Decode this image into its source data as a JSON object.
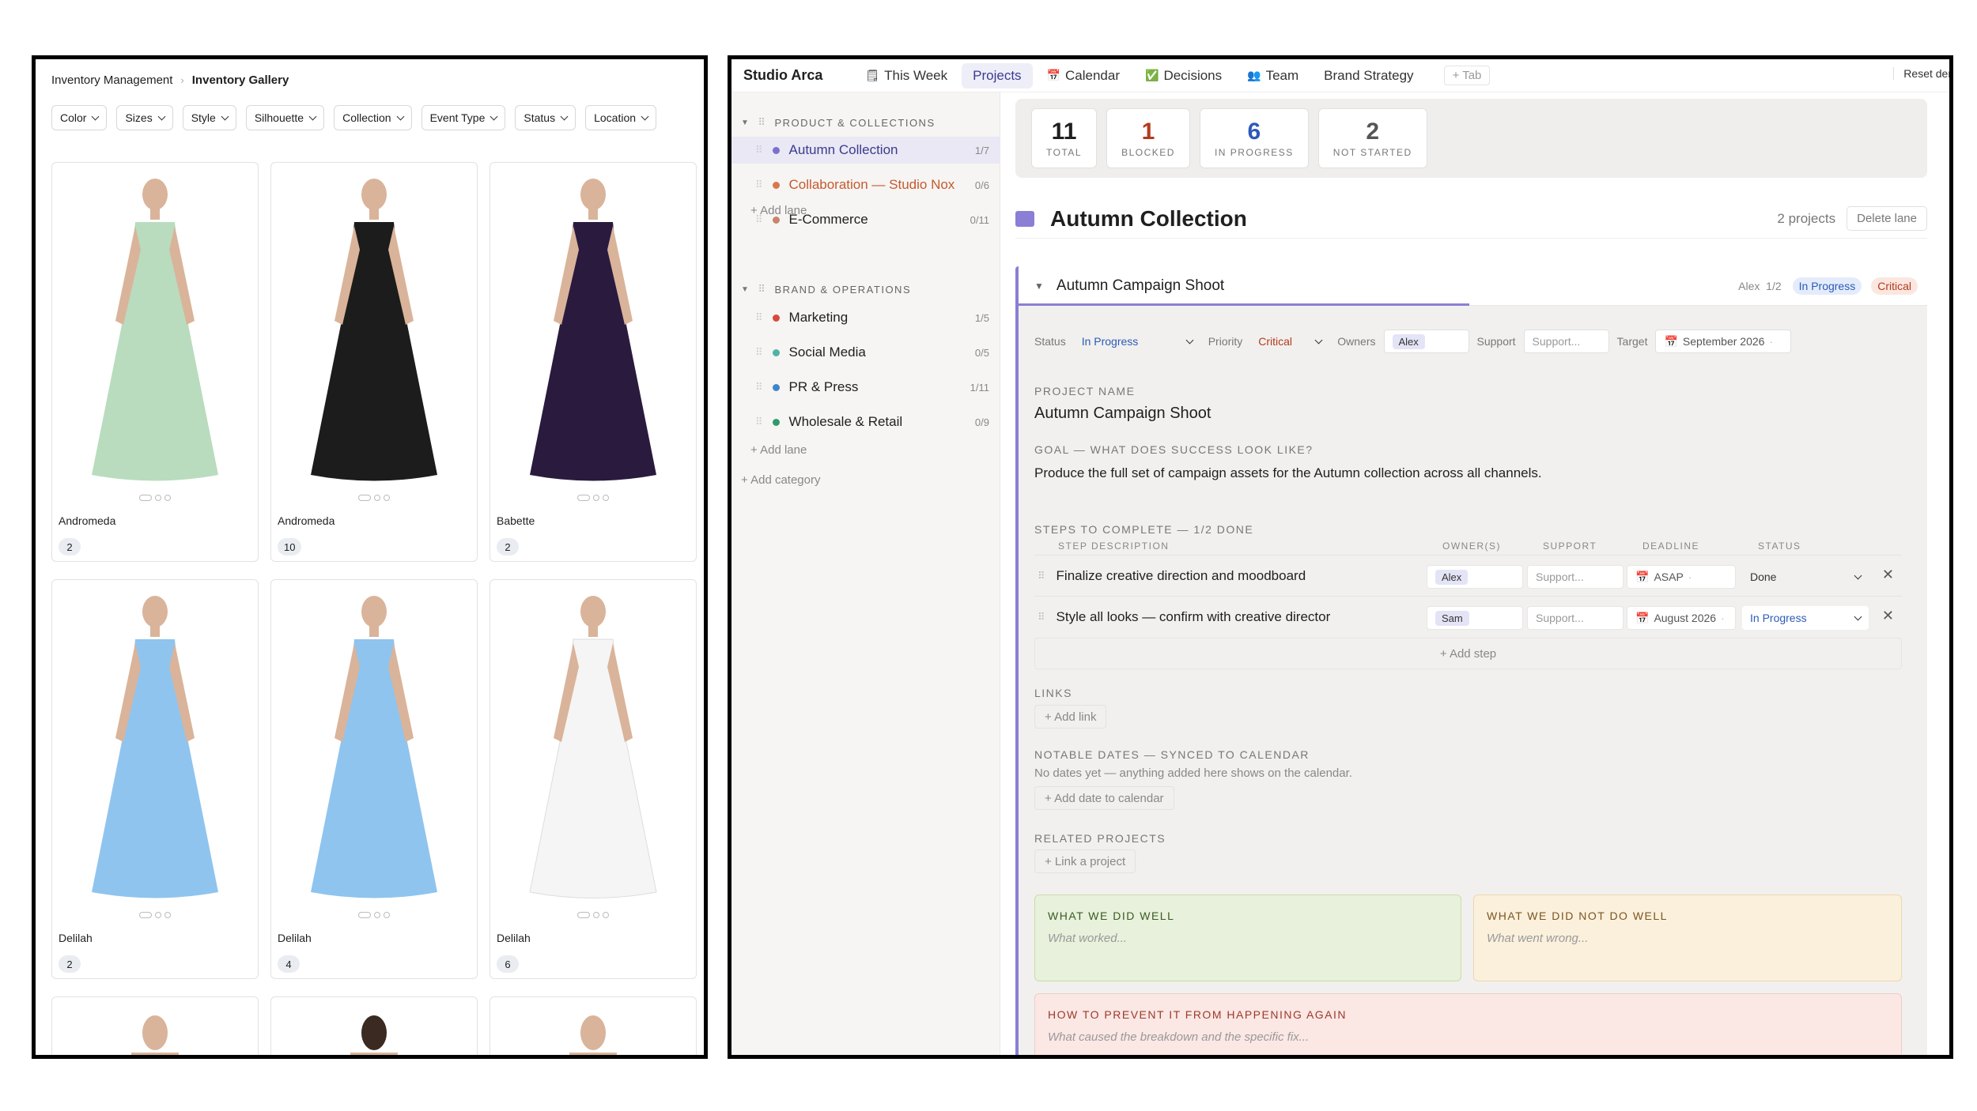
{
  "gallery": {
    "breadcrumb": [
      "Inventory Management",
      "Inventory Gallery"
    ],
    "filters": [
      "Color",
      "Sizes",
      "Style",
      "Silhouette",
      "Collection",
      "Event Type",
      "Status",
      "Location"
    ],
    "items": [
      {
        "name": "Andromeda",
        "count": "2",
        "color": "#b9dcbf"
      },
      {
        "name": "Andromeda",
        "count": "10",
        "color": "#1c1c1c"
      },
      {
        "name": "Babette",
        "count": "2",
        "color": "#2a1a3e"
      },
      {
        "name": "Delilah",
        "count": "2",
        "color": "#8fc4ee"
      },
      {
        "name": "Delilah",
        "count": "4",
        "color": "#8fc4ee"
      },
      {
        "name": "Delilah",
        "count": "6",
        "color": "#f5f5f5"
      }
    ]
  },
  "app": {
    "brand": "Studio Arca",
    "tabs": [
      {
        "label": "This Week",
        "icon": "🗒"
      },
      {
        "label": "Projects",
        "icon": ""
      },
      {
        "label": "Calendar",
        "icon": "📅"
      },
      {
        "label": "Decisions",
        "icon": "✅"
      },
      {
        "label": "Team",
        "icon": "👥"
      },
      {
        "label": "Brand Strategy",
        "icon": ""
      }
    ],
    "add_tab": "+ Tab",
    "reset": "Reset dem"
  },
  "sidebar": {
    "categories": [
      {
        "label": "PRODUCT & COLLECTIONS",
        "lanes": [
          {
            "label": "Autumn Collection",
            "count": "1/7",
            "color": "#7b6fd0"
          },
          {
            "label": "Collaboration — Studio Nox",
            "count": "0/6",
            "color": "#d9774a"
          },
          {
            "label": "E-Commerce",
            "count": "0/11",
            "color": "#c9846a"
          }
        ]
      },
      {
        "label": "BRAND & OPERATIONS",
        "lanes": [
          {
            "label": "Marketing",
            "count": "1/5",
            "color": "#d9493b"
          },
          {
            "label": "Social Media",
            "count": "0/5",
            "color": "#4fb3a5"
          },
          {
            "label": "PR & Press",
            "count": "1/11",
            "color": "#3f86c9"
          },
          {
            "label": "Wholesale & Retail",
            "count": "0/9",
            "color": "#2f9a6c"
          }
        ]
      }
    ],
    "add_lane": "+ Add lane",
    "add_category": "+ Add category"
  },
  "stats": [
    {
      "n": "11",
      "l": "TOTAL",
      "color": "#1f1f1f"
    },
    {
      "n": "1",
      "l": "BLOCKED",
      "color": "#b23b1d"
    },
    {
      "n": "6",
      "l": "IN PROGRESS",
      "color": "#2c5ab8"
    },
    {
      "n": "2",
      "l": "NOT STARTED",
      "color": "#555555"
    }
  ],
  "lane": {
    "title": "Autumn Collection",
    "projects": "2 projects",
    "delete": "Delete lane"
  },
  "project": {
    "title": "Autumn Campaign Shoot",
    "owners_short": "Alex",
    "progress": "1/2",
    "status": "In Progress",
    "priority": "Critical",
    "fields": {
      "status_label": "Status",
      "status_value": "In Progress",
      "priority_label": "Priority",
      "priority_value": "Critical",
      "owners_label": "Owners",
      "owners_value": "Alex",
      "support_label": "Support",
      "support_placeholder": "Support...",
      "target_label": "Target",
      "target_value": "September 2026"
    },
    "name_label": "PROJECT NAME",
    "name_value": "Autumn Campaign Shoot",
    "goal_label": "GOAL — WHAT DOES SUCCESS LOOK LIKE?",
    "goal_value": "Produce the full set of campaign assets for the Autumn collection across all channels.",
    "steps_label": "STEPS TO COMPLETE — 1/2 DONE",
    "steps_cols": [
      "STEP DESCRIPTION",
      "OWNER(S)",
      "SUPPORT",
      "DEADLINE",
      "STATUS"
    ],
    "steps": [
      {
        "desc": "Finalize creative direction and moodboard",
        "owner": "Alex",
        "support": "Support...",
        "deadline": "ASAP",
        "status": "Done"
      },
      {
        "desc": "Style all looks — confirm with creative director",
        "owner": "Sam",
        "support": "Support...",
        "deadline": "August 2026",
        "status": "In Progress"
      }
    ],
    "add_step": "+ Add step",
    "links_label": "LINKS",
    "add_link": "+ Add link",
    "dates_label": "NOTABLE DATES — SYNCED TO CALENDAR",
    "dates_note": "No dates yet — anything added here shows on the calendar.",
    "add_date": "+ Add date to calendar",
    "related_label": "RELATED PROJECTS",
    "link_project": "+ Link a project",
    "well_title": "WHAT WE DID WELL",
    "well_ph": "What worked...",
    "notwell_title": "WHAT WE DID NOT DO WELL",
    "notwell_ph": "What went wrong...",
    "prevent_title": "HOW TO PREVENT IT FROM HAPPENING AGAIN",
    "prevent_ph": "What caused the breakdown and the specific fix..."
  }
}
